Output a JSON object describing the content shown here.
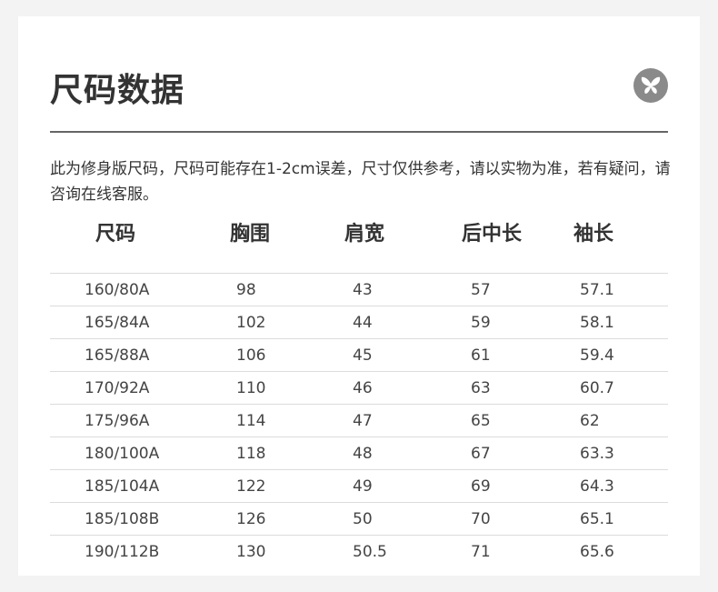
{
  "title": "尺码数据",
  "logo_icon": "butterfly-icon",
  "description": "此为修身版尺码，尺码可能存在1-2cm误差，尺寸仅供参考，请以实物为准，若有疑问，请咨询在线客服。",
  "table": {
    "headers": [
      "尺码",
      "胸围",
      "肩宽",
      "后中长",
      "袖长"
    ],
    "rows": [
      [
        "160/80A",
        "98",
        "43",
        "57",
        "57.1"
      ],
      [
        "165/84A",
        "102",
        "44",
        "59",
        "58.1"
      ],
      [
        "165/88A",
        "106",
        "45",
        "61",
        "59.4"
      ],
      [
        "170/92A",
        "110",
        "46",
        "63",
        "60.7"
      ],
      [
        "175/96A",
        "114",
        "47",
        "65",
        "62"
      ],
      [
        "180/100A",
        "118",
        "48",
        "67",
        "63.3"
      ],
      [
        "185/104A",
        "122",
        "49",
        "69",
        "64.3"
      ],
      [
        "185/108B",
        "126",
        "50",
        "70",
        "65.1"
      ],
      [
        "190/112B",
        "130",
        "50.5",
        "71",
        "65.6"
      ]
    ]
  }
}
